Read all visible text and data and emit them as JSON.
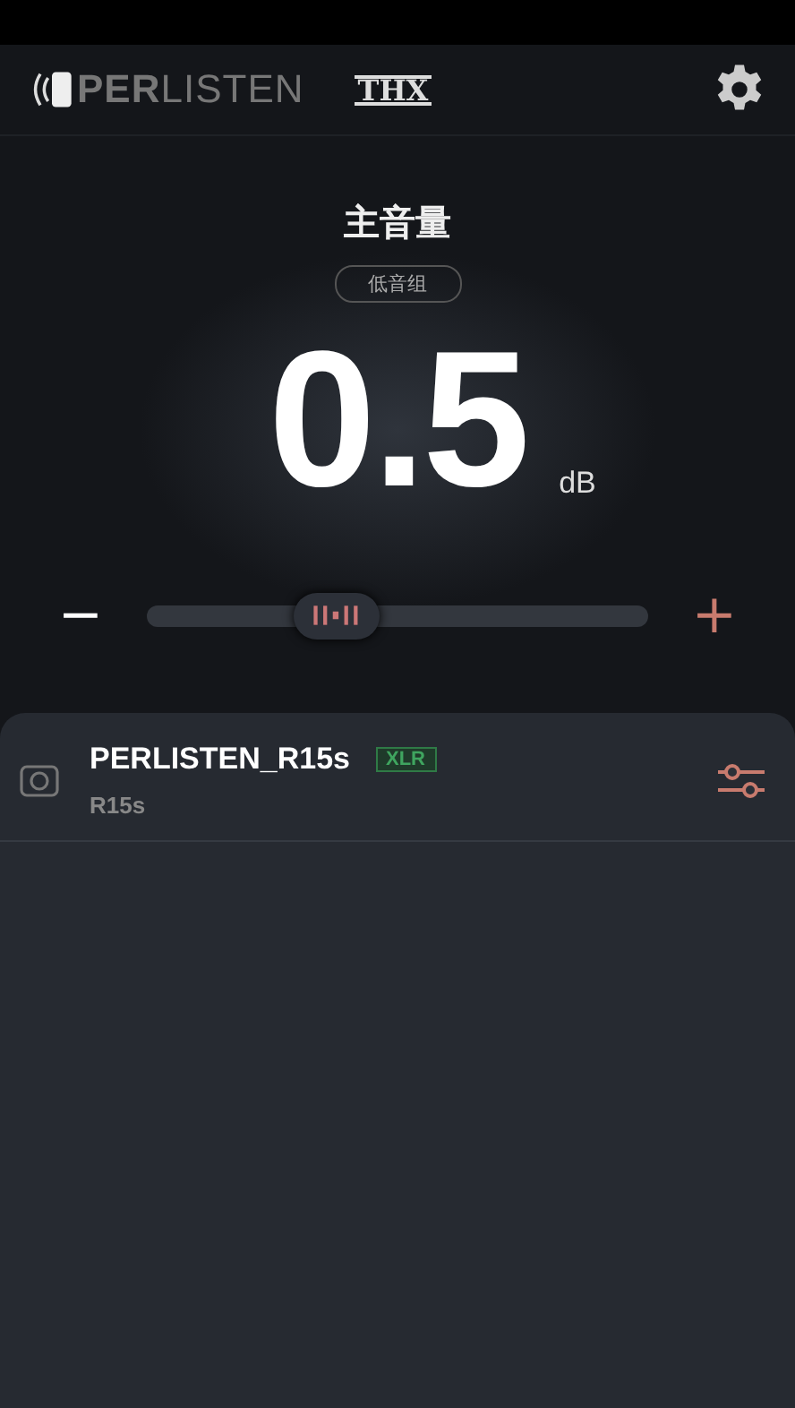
{
  "header": {
    "logo": "**PER**LISTEN",
    "certification": "THX"
  },
  "volume": {
    "title": "主音量",
    "group": "低音组",
    "value": "0.5",
    "unit": "dB",
    "minus": "−",
    "plus": "+",
    "level": 0.38
  },
  "devices": [
    {
      "name": "PERLISTEN_R15s",
      "tag": "XLR",
      "model": "R15s"
    }
  ]
}
